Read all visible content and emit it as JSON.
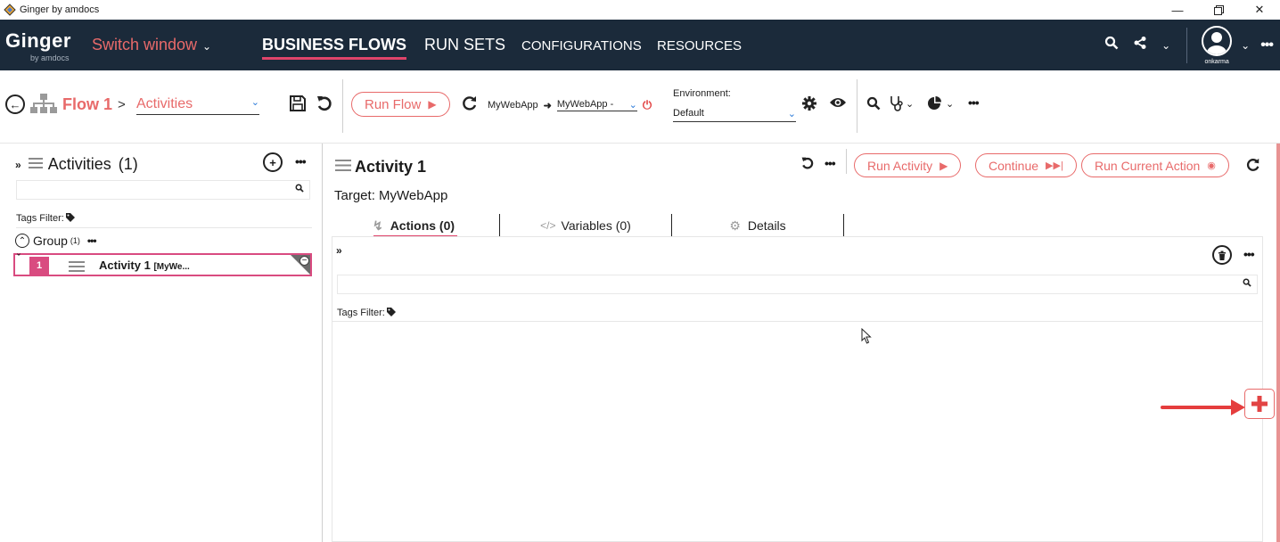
{
  "window": {
    "title": "Ginger by amdocs"
  },
  "nav": {
    "brand": "Ginger",
    "brand_sub": "by amdocs",
    "switch_window": "Switch window",
    "tabs": [
      {
        "label": "BUSINESS FLOWS",
        "active": true
      },
      {
        "label": "RUN SETS",
        "active": false
      },
      {
        "label": "CONFIGURATIONS",
        "active": false
      },
      {
        "label": "RESOURCES",
        "active": false
      }
    ],
    "username": "onkarma"
  },
  "toolbar": {
    "flow_name": "Flow 1",
    "crumb_sep": ">",
    "view_select": "Activities",
    "run_flow": "Run Flow",
    "app_source": "MyWebApp",
    "app_target": "MyWebApp -",
    "environment_label": "Environment:",
    "environment_value": "Default"
  },
  "left": {
    "title": "Activities",
    "count": "(1)",
    "search_placeholder": "",
    "tags_filter": "Tags Filter:",
    "group_label": "Group",
    "group_count": "(1)",
    "activity": {
      "number": "1",
      "name": "Activity 1",
      "suffix": "[MyWe..."
    }
  },
  "right": {
    "title": "Activity 1",
    "run_activity": "Run Activity",
    "continue": "Continue",
    "run_current_action": "Run Current Action",
    "target": "Target: MyWebApp",
    "tabs": [
      {
        "label": "Actions (0)",
        "icon": "bolt-icon",
        "active": true
      },
      {
        "label": "Variables (0)",
        "icon": "code-icon",
        "active": false
      },
      {
        "label": "Details",
        "icon": "gear-icon",
        "active": false
      }
    ],
    "tags_filter": "Tags Filter:"
  },
  "colors": {
    "nav_bg": "#1b2a3a",
    "accent": "#e86a6a",
    "pink": "#d94b80",
    "arrow": "#e53d3d"
  }
}
